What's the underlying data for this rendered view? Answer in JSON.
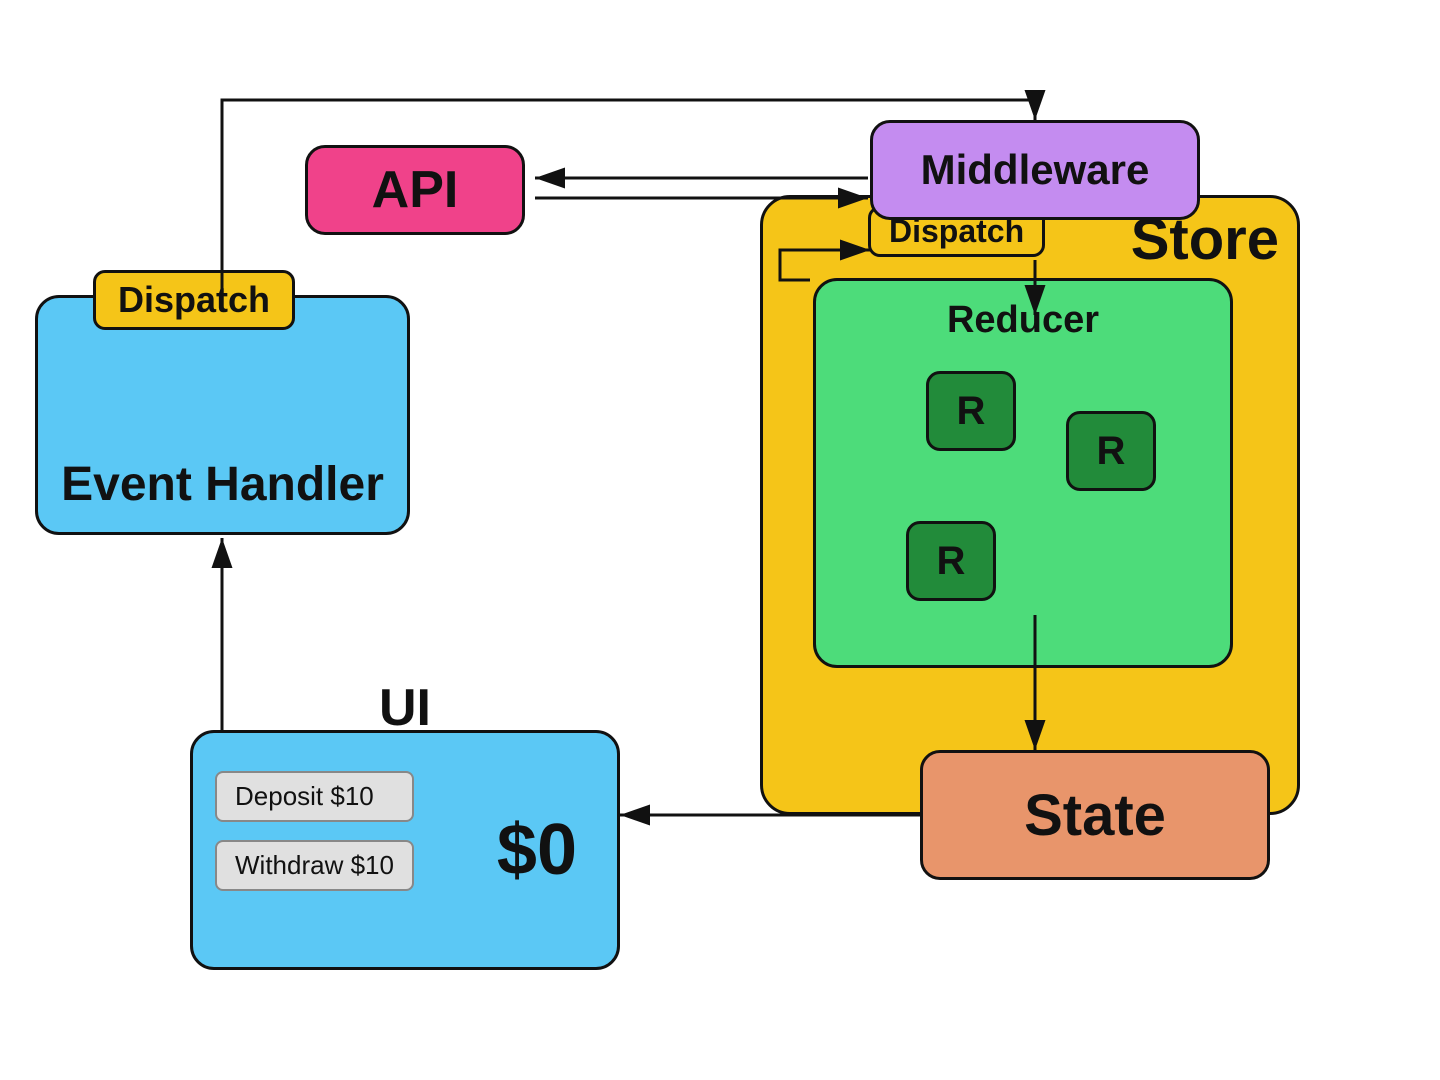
{
  "api": {
    "label": "API"
  },
  "middleware": {
    "label": "Middleware"
  },
  "store": {
    "label": "Store",
    "dispatch_badge": "Dispatch"
  },
  "reducer": {
    "label": "Reducer",
    "r_boxes": [
      "R",
      "R",
      "R"
    ]
  },
  "state": {
    "label": "State"
  },
  "event_handler": {
    "label": "Event Handler",
    "dispatch_badge": "Dispatch"
  },
  "ui": {
    "label": "UI",
    "dollar_label": "$0",
    "buttons": [
      "Deposit $10",
      "Withdraw $10"
    ]
  }
}
